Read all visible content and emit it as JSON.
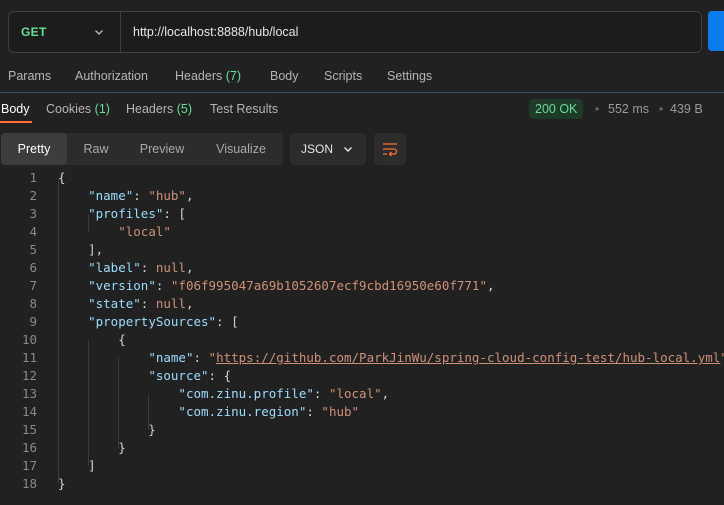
{
  "request": {
    "method": "GET",
    "url": "http://localhost:8888/hub/local"
  },
  "request_tabs": [
    {
      "label": "Params"
    },
    {
      "label": "Authorization"
    },
    {
      "label": "Headers",
      "count": "(7)"
    },
    {
      "label": "Body"
    },
    {
      "label": "Scripts"
    },
    {
      "label": "Settings"
    }
  ],
  "response_tabs": [
    {
      "label": "Body"
    },
    {
      "label": "Cookies",
      "count": "(1)"
    },
    {
      "label": "Headers",
      "count": "(5)"
    },
    {
      "label": "Test Results"
    }
  ],
  "response_meta": {
    "status": "200 OK",
    "time": "552 ms",
    "size": "439 B"
  },
  "view_modes": [
    "Pretty",
    "Raw",
    "Preview",
    "Visualize"
  ],
  "active_view": "Pretty",
  "format": "JSON",
  "icons": {
    "method_dropdown": "chevron-down-icon",
    "format_dropdown": "chevron-down-icon",
    "wrap": "wrap-lines-icon"
  },
  "colors": {
    "accent": "#ff6c37",
    "method": "#6bdd9a",
    "status": "#6bdd9a",
    "json_key": "#9cdcfe",
    "json_string": "#ce9178"
  },
  "code_lines": [
    {
      "n": "1",
      "t": [
        [
          "p",
          "{"
        ]
      ]
    },
    {
      "n": "2",
      "t": [
        [
          "p",
          "    "
        ],
        [
          "k",
          "\"name\""
        ],
        [
          "p",
          ": "
        ],
        [
          "s",
          "\"hub\""
        ],
        [
          "p",
          ","
        ]
      ]
    },
    {
      "n": "3",
      "t": [
        [
          "p",
          "    "
        ],
        [
          "k",
          "\"profiles\""
        ],
        [
          "p",
          ": ["
        ]
      ]
    },
    {
      "n": "4",
      "t": [
        [
          "p",
          "        "
        ],
        [
          "s",
          "\"local\""
        ]
      ]
    },
    {
      "n": "5",
      "t": [
        [
          "p",
          "    ],"
        ]
      ]
    },
    {
      "n": "6",
      "t": [
        [
          "p",
          "    "
        ],
        [
          "k",
          "\"label\""
        ],
        [
          "p",
          ": "
        ],
        [
          "n",
          "null"
        ],
        [
          "p",
          ","
        ]
      ]
    },
    {
      "n": "7",
      "t": [
        [
          "p",
          "    "
        ],
        [
          "k",
          "\"version\""
        ],
        [
          "p",
          ": "
        ],
        [
          "s",
          "\"f06f995047a69b1052607ecf9cbd16950e60f771\""
        ],
        [
          "p",
          ","
        ]
      ]
    },
    {
      "n": "8",
      "t": [
        [
          "p",
          "    "
        ],
        [
          "k",
          "\"state\""
        ],
        [
          "p",
          ": "
        ],
        [
          "n",
          "null"
        ],
        [
          "p",
          ","
        ]
      ]
    },
    {
      "n": "9",
      "t": [
        [
          "p",
          "    "
        ],
        [
          "k",
          "\"propertySources\""
        ],
        [
          "p",
          ": ["
        ]
      ]
    },
    {
      "n": "10",
      "t": [
        [
          "p",
          "        {"
        ]
      ]
    },
    {
      "n": "11",
      "t": [
        [
          "p",
          "            "
        ],
        [
          "k",
          "\"name\""
        ],
        [
          "p",
          ": "
        ],
        [
          "s",
          "\""
        ],
        [
          "u",
          "https://github.com/ParkJinWu/spring-cloud-config-test/hub-local.yml"
        ],
        [
          "s",
          "\""
        ],
        [
          "p",
          ","
        ]
      ]
    },
    {
      "n": "12",
      "t": [
        [
          "p",
          "            "
        ],
        [
          "k",
          "\"source\""
        ],
        [
          "p",
          ": {"
        ]
      ]
    },
    {
      "n": "13",
      "t": [
        [
          "p",
          "                "
        ],
        [
          "k",
          "\"com.zinu.profile\""
        ],
        [
          "p",
          ": "
        ],
        [
          "s",
          "\"local\""
        ],
        [
          "p",
          ","
        ]
      ]
    },
    {
      "n": "14",
      "t": [
        [
          "p",
          "                "
        ],
        [
          "k",
          "\"com.zinu.region\""
        ],
        [
          "p",
          ": "
        ],
        [
          "s",
          "\"hub\""
        ]
      ]
    },
    {
      "n": "15",
      "t": [
        [
          "p",
          "            }"
        ]
      ]
    },
    {
      "n": "16",
      "t": [
        [
          "p",
          "        }"
        ]
      ]
    },
    {
      "n": "17",
      "t": [
        [
          "p",
          "    ]"
        ]
      ]
    },
    {
      "n": "18",
      "t": [
        [
          "p",
          "}"
        ]
      ]
    }
  ]
}
